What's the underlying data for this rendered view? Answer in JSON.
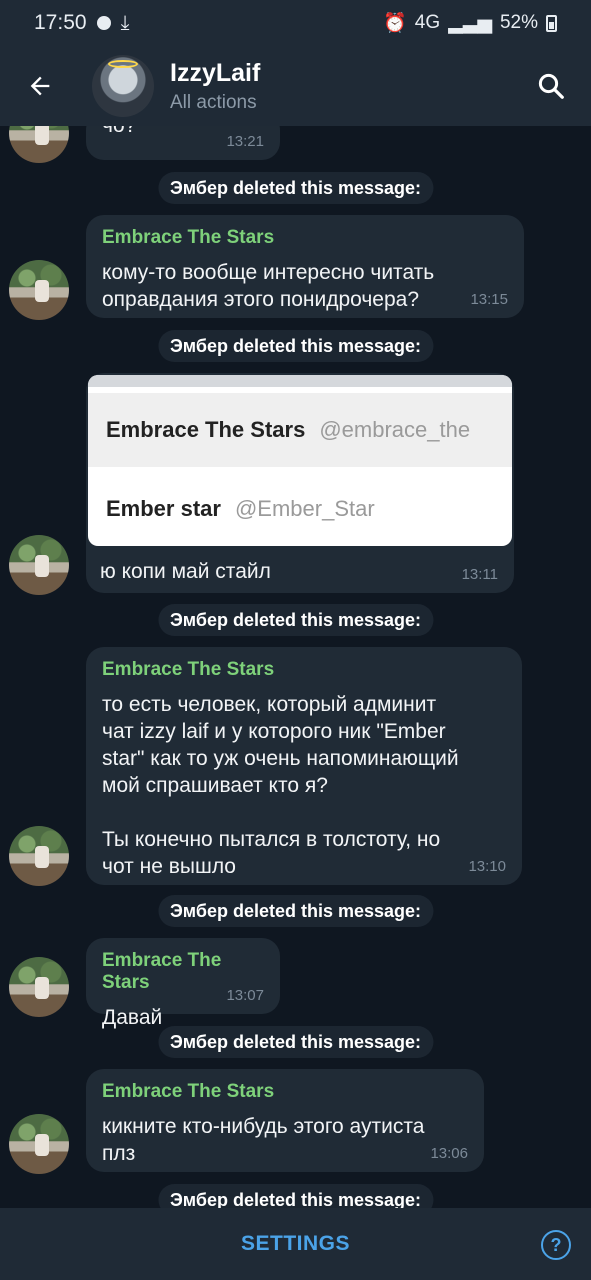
{
  "status_bar": {
    "time": "17:50",
    "battery": "52%",
    "network": "4G"
  },
  "header": {
    "title": "IzzyLaif",
    "subtitle": "All actions"
  },
  "service_text": "Эмбер deleted this message:",
  "messages": [
    {
      "sender": "",
      "text": "чо?",
      "time": "13:21"
    },
    {
      "sender": "Embrace The Stars",
      "text": "кому-то вообще интересно читать\nоправдания этого понидрочера?",
      "time": "13:15"
    },
    {
      "sender": "",
      "text": "ю копи май стайл",
      "time": "13:11",
      "photo": {
        "name1": "Embrace The Stars",
        "handle1": "@embrace_the",
        "name2": "Ember star",
        "handle2": "@Ember_Star"
      }
    },
    {
      "sender": "Embrace The Stars",
      "text": "то есть человек, который админит\nчат izzy laif и у которого ник \"Ember\nstar\" как то уж очень напоминающий\nмой спрашивает кто я?\n\nТы конечно пытался в толстоту, но\nчот не вышло",
      "time": "13:10"
    },
    {
      "sender": "Embrace The Stars",
      "text": "Давай",
      "time": "13:07"
    },
    {
      "sender": "Embrace The Stars",
      "text": "кикните кто-нибудь этого аутиста\nплз",
      "time": "13:06"
    }
  ],
  "footer": {
    "settings_label": "SETTINGS",
    "help_label": "?"
  },
  "colors": {
    "background": "#0f1721",
    "bar": "#1f2a36",
    "bubble": "#202b36",
    "sender": "#7ed17a",
    "accent": "#4ba3e8"
  }
}
